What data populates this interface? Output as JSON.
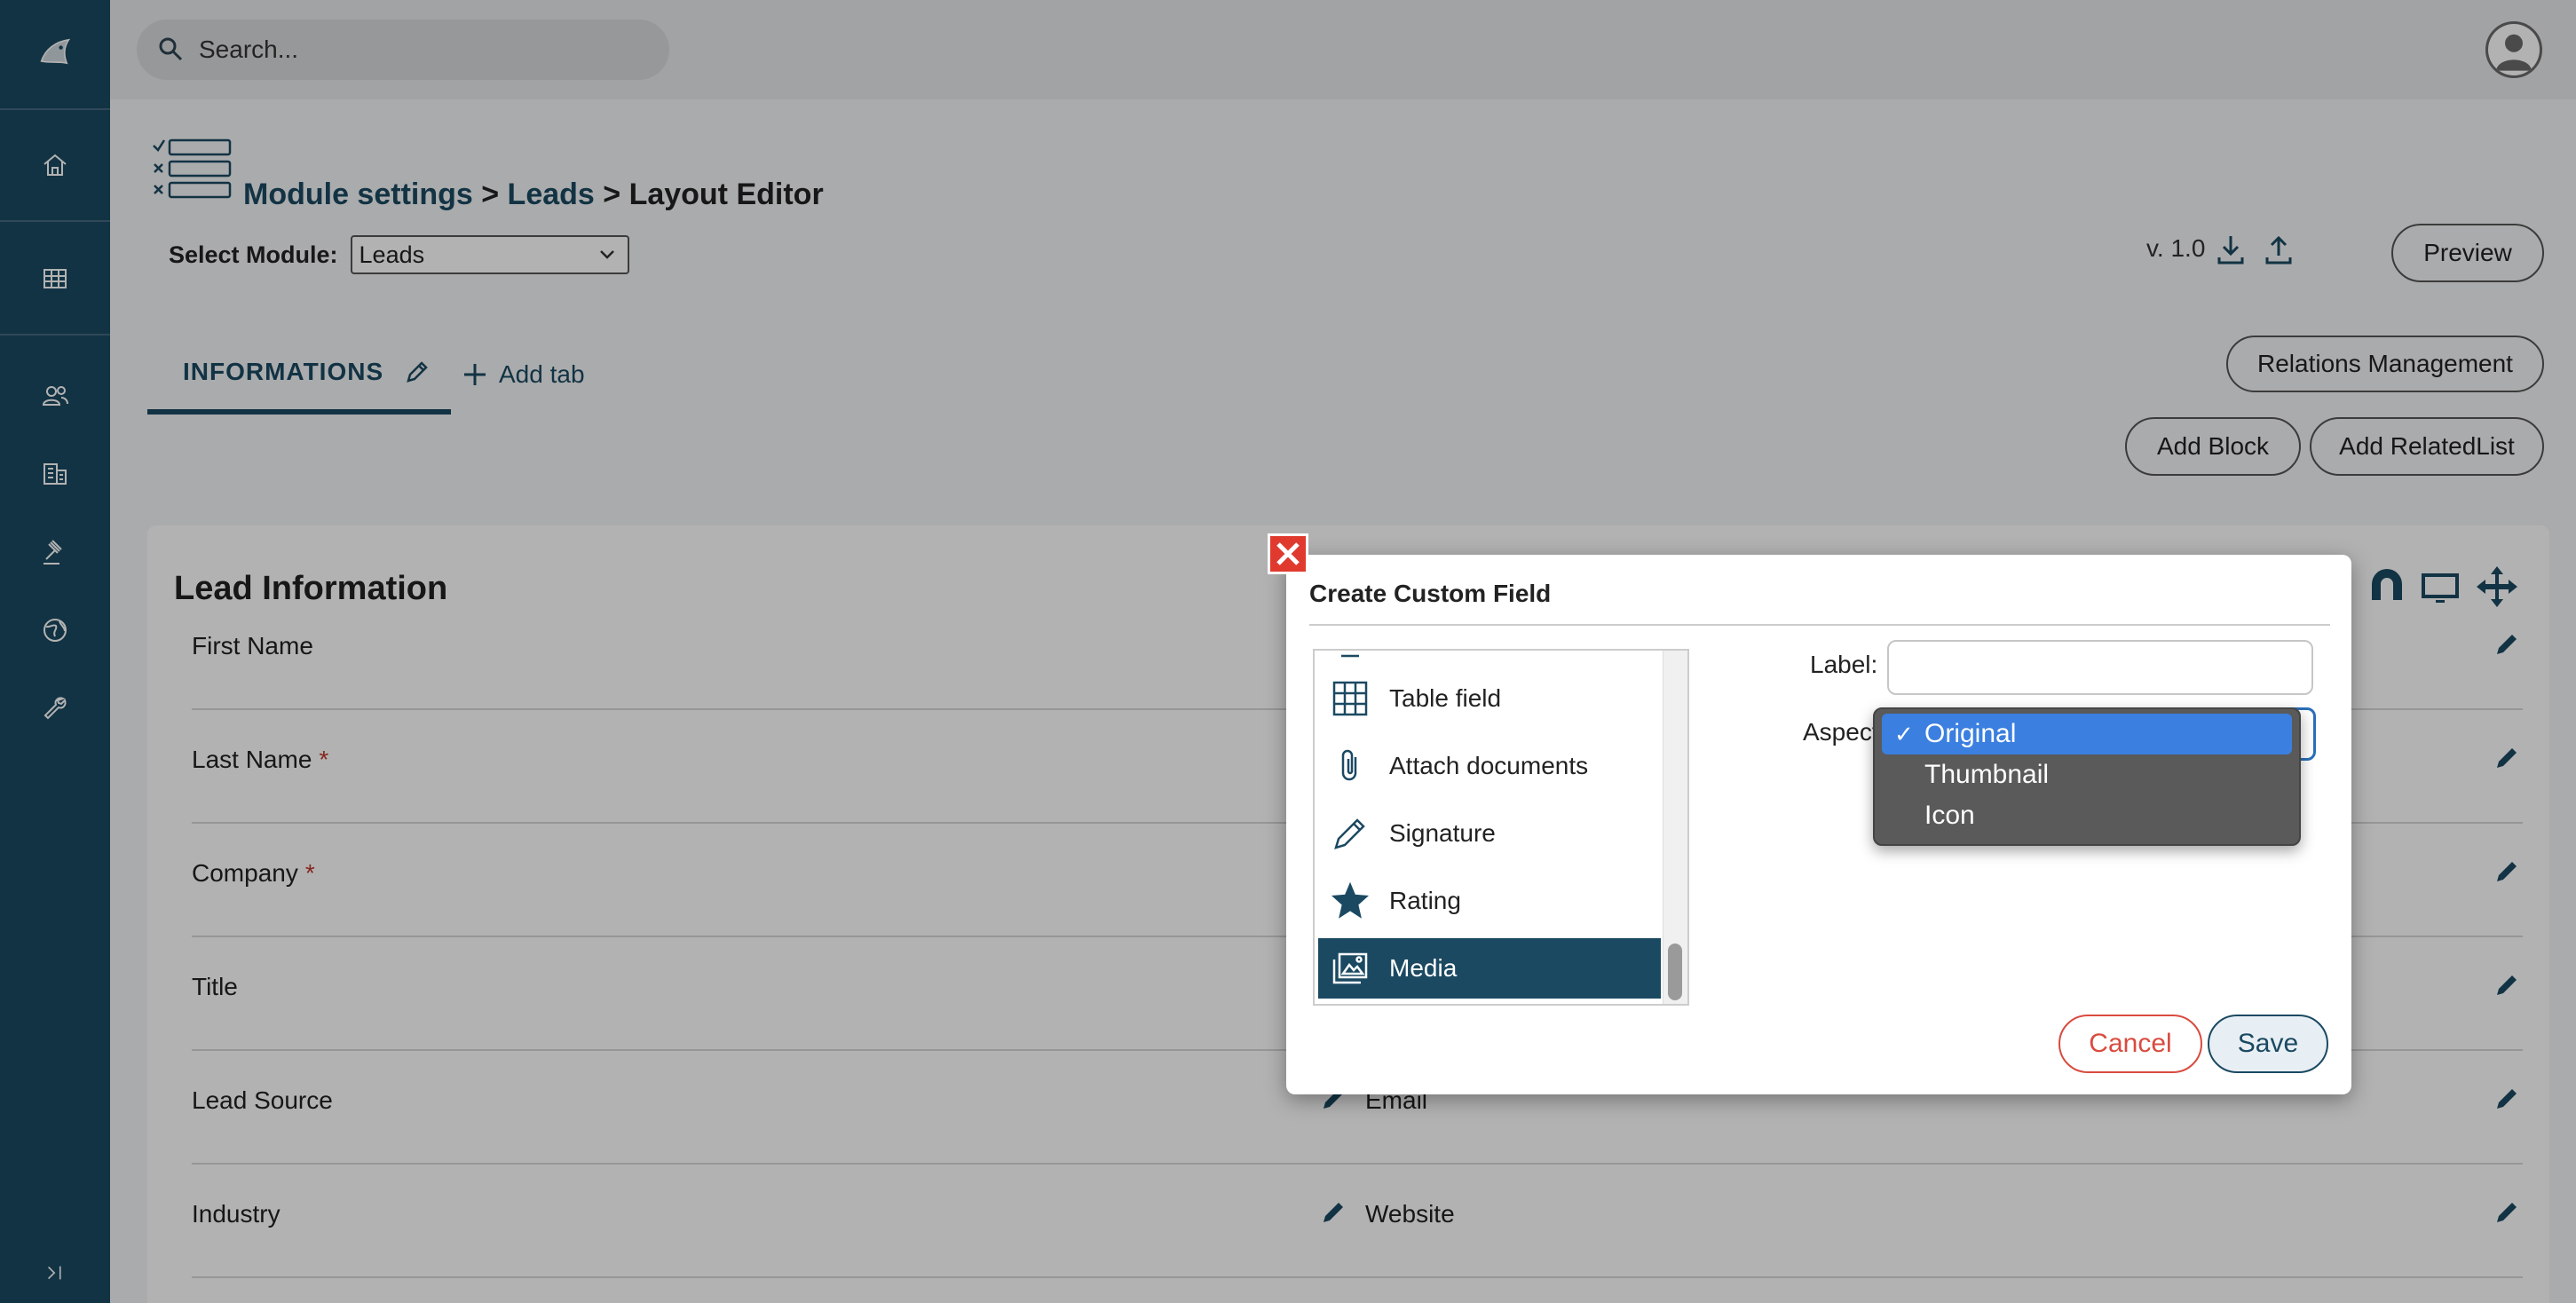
{
  "app": {
    "sidebar": {
      "items": [
        {
          "name": "home",
          "icon": "home-icon"
        },
        {
          "name": "grid",
          "icon": "grid-icon"
        },
        {
          "name": "contacts",
          "icon": "people-icon"
        },
        {
          "name": "accounts",
          "icon": "building-icon"
        },
        {
          "name": "tools",
          "icon": "gavel-icon"
        },
        {
          "name": "web",
          "icon": "globe-icon"
        },
        {
          "name": "settings",
          "icon": "wrench-icon"
        }
      ],
      "expand_icon": "expand-icon"
    },
    "search": {
      "placeholder": "Search..."
    },
    "accent": "#1b4962"
  },
  "breadcrumb": {
    "part1": "Module settings",
    "sep1": " > ",
    "part2": "Leads",
    "sep2": " > ",
    "current": "Layout Editor"
  },
  "module_select": {
    "label": "Select Module:",
    "value": "Leads"
  },
  "version": {
    "label": "v. 1.0"
  },
  "buttons": {
    "preview": "Preview",
    "relations": "Relations Management",
    "add_block": "Add Block",
    "add_relatedlist": "Add RelatedList"
  },
  "tabs": {
    "active": "INFORMATIONS",
    "add": "Add tab"
  },
  "block": {
    "title": "Lead Information",
    "rows": [
      {
        "left": "First Name",
        "left_required": false,
        "right": "",
        "right_required": false
      },
      {
        "left": "Last Name",
        "left_required": true,
        "right": "",
        "right_required": false
      },
      {
        "left": "Company",
        "left_required": true,
        "right": "",
        "right_required": false
      },
      {
        "left": "Title",
        "left_required": false,
        "right": "",
        "right_required": false
      },
      {
        "left": "Lead Source",
        "left_required": false,
        "right": "Email",
        "right_required": false
      },
      {
        "left": "Industry",
        "left_required": false,
        "right": "Website",
        "right_required": false
      }
    ],
    "required_mark": "*"
  },
  "modal": {
    "title": "Create Custom Field",
    "field_types": [
      {
        "label": "Table field",
        "icon": "table-icon",
        "selected": false
      },
      {
        "label": "Attach documents",
        "icon": "paperclip-icon",
        "selected": false
      },
      {
        "label": "Signature",
        "icon": "pencil-icon",
        "selected": false
      },
      {
        "label": "Rating",
        "icon": "star-icon",
        "selected": false
      },
      {
        "label": "Media",
        "icon": "media-icon",
        "selected": true
      }
    ],
    "label_field": {
      "label": "Label:",
      "value": ""
    },
    "aspect_field": {
      "label": "Aspect",
      "value": "Original"
    },
    "cancel": "Cancel",
    "save": "Save"
  },
  "aspect_dropdown": {
    "options": [
      {
        "label": "Original",
        "selected": true
      },
      {
        "label": "Thumbnail",
        "selected": false
      },
      {
        "label": "Icon",
        "selected": false
      }
    ],
    "check": "✓"
  }
}
